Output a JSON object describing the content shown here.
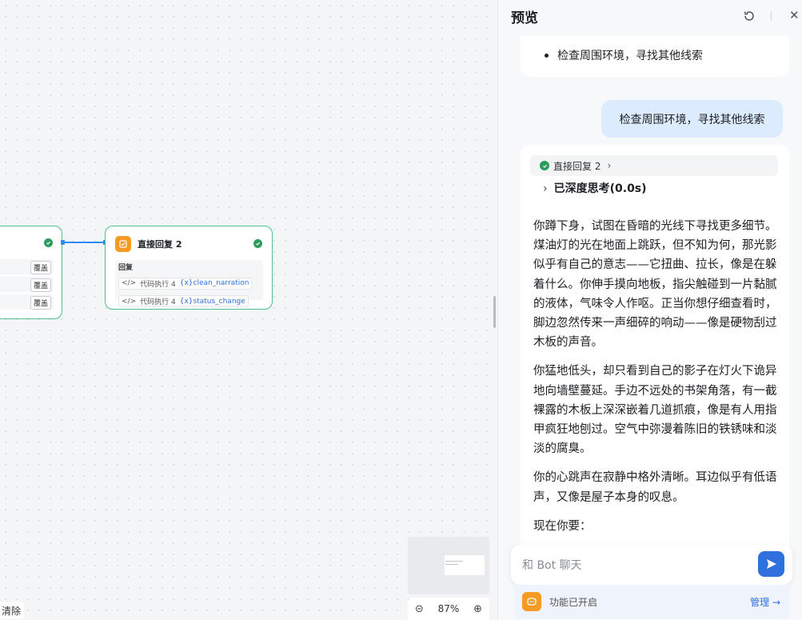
{
  "canvas": {
    "left_node": {
      "rows": [
        {
          "tag": "覆盖"
        },
        {
          "tag": "覆盖"
        },
        {
          "tag": "覆盖"
        }
      ]
    },
    "reply_node": {
      "title": "直接回复 2",
      "body_label": "回复",
      "vars": [
        {
          "source": "代码执行 4",
          "name": "clean_narration"
        },
        {
          "source": "代码执行 4",
          "name": "status_change"
        }
      ]
    },
    "zoom": "87%",
    "clear_label": "清除"
  },
  "panel": {
    "title": "预览",
    "prev_bullet": "检查周围环境，寻找其他线索",
    "user_message": "检查周围环境，寻找其他线索",
    "bot": {
      "status": "直接回复 2",
      "thinking": "已深度思考(0.0s)",
      "paragraphs": [
        "你蹲下身，试图在昏暗的光线下寻找更多细节。煤油灯的光在地面上跳跃，但不知为何，那光影似乎有自己的意志——它扭曲、拉长，像是在躲着什么。你伸手摸向地板，指尖触碰到一片黏腻的液体，气味令人作呕。正当你想仔细查看时，脚边忽然传来一声细碎的响动——像是硬物刮过木板的声音。",
        "你猛地低头，却只看到自己的影子在灯火下诡异地向墙壁蔓延。手边不远处的书架角落，有一截裸露的木板上深深嵌着几道抓痕，像是有人用指甲疯狂地刨过。空气中弥漫着陈旧的铁锈味和淡淡的腐臭。",
        "你的心跳声在寂静中格外清晰。耳边似乎有低语声，又像是屋子本身的叹息。",
        "现在你要："
      ]
    },
    "composer_placeholder": "和 Bot 聊天",
    "feature_label": "功能已开启",
    "manage_label": "管理"
  },
  "colors": {
    "accent": "#2f6fde",
    "success": "#2a9d5c",
    "node_icon": "#f59a23",
    "user_bubble": "#dcebfd"
  }
}
